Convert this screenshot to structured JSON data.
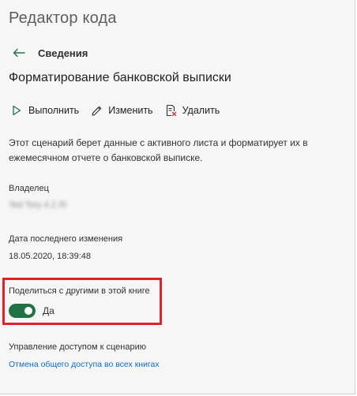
{
  "app": {
    "title": "Редактор кода"
  },
  "nav": {
    "back_icon": "arrow-left-icon",
    "title": "Сведения"
  },
  "script": {
    "title": "Форматирование банковской выписки",
    "description": "Этот сценарий берет данные с активного листа и форматирует их в ежемесячном отчете о банковской выписке."
  },
  "toolbar": {
    "run_label": "Выполнить",
    "run_icon": "play-icon",
    "edit_label": "Изменить",
    "edit_icon": "pencil-icon",
    "delete_label": "Удалить",
    "delete_icon": "delete-document-icon"
  },
  "owner": {
    "label": "Владелец",
    "value": "Ted Tory 4.2 ЛІ"
  },
  "modified": {
    "label": "Дата последнего изменения",
    "value": "18.05.2020, 18:39:48"
  },
  "share": {
    "label": "Поделиться с другими в этой книге",
    "toggle_on": true,
    "toggle_text": "Да"
  },
  "access": {
    "label": "Управление доступом к сценарию",
    "link_text": "Отмена общего доступа во всех книгах"
  },
  "colors": {
    "accent_green": "#217346",
    "link_blue": "#0f6cbd",
    "highlight_red": "#e3202a",
    "background": "#f6f6f6"
  }
}
